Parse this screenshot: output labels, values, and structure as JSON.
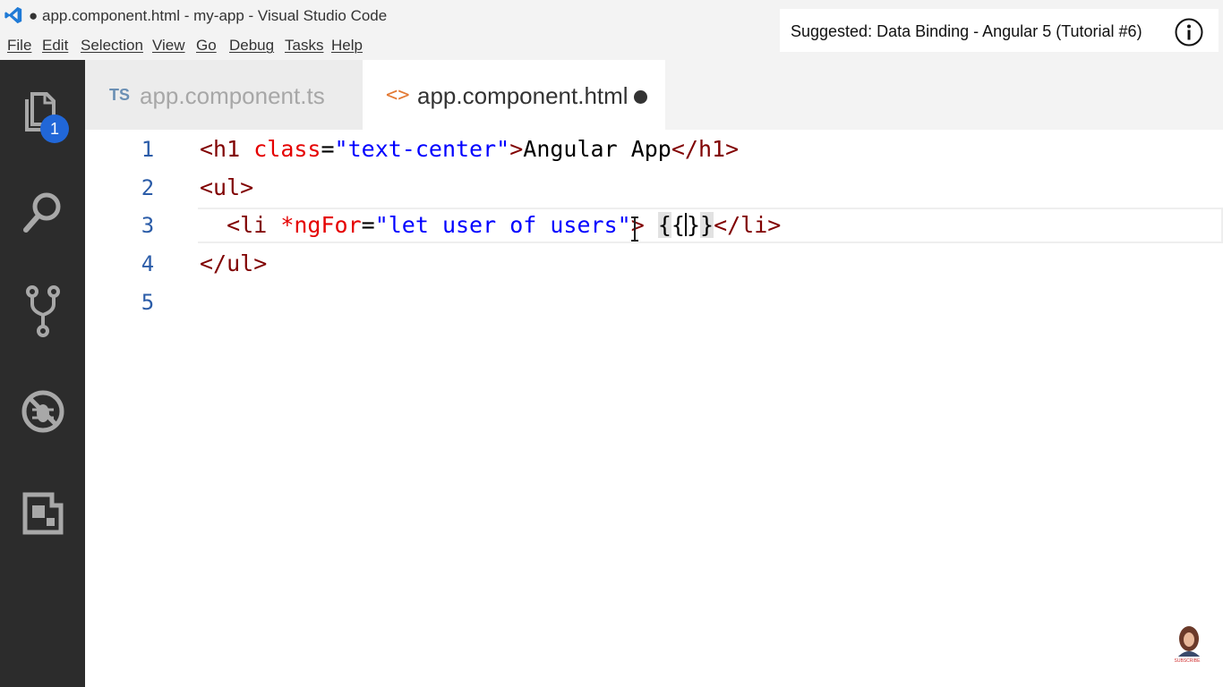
{
  "window": {
    "title": "● app.component.html - my-app - Visual Studio Code",
    "logo_icon": "vscode-logo-icon"
  },
  "menu": [
    "File",
    "Edit",
    "Selection",
    "View",
    "Go",
    "Debug",
    "Tasks",
    "Help"
  ],
  "suggestion": {
    "text": "Suggested: Data Binding - Angular 5 (Tutorial #6)",
    "icon": "info-icon"
  },
  "activity_bar": {
    "items": [
      "explorer-icon",
      "search-icon",
      "source-control-icon",
      "debug-icon",
      "extensions-icon"
    ],
    "explorer_badge": "1",
    "background": "#2c2c2c"
  },
  "tabs": [
    {
      "icon_text": "TS",
      "label": "app.component.ts",
      "active": false
    },
    {
      "icon_text": "<>",
      "label": "app.component.html",
      "active": true,
      "dirty": true
    }
  ],
  "editor": {
    "line_numbers": [
      "1",
      "2",
      "3",
      "4",
      "5"
    ],
    "lines": [
      [
        {
          "cls": "t-tag",
          "text": "<h1"
        },
        {
          "cls": "t-punct",
          "text": " "
        },
        {
          "cls": "t-attr",
          "text": "class"
        },
        {
          "cls": "t-punct",
          "text": "="
        },
        {
          "cls": "t-str",
          "text": "\"text-center\""
        },
        {
          "cls": "t-tag",
          "text": ">"
        },
        {
          "cls": "t-punct",
          "text": "Angular App"
        },
        {
          "cls": "t-tag",
          "text": "</h1>"
        }
      ],
      [
        {
          "cls": "t-tag",
          "text": "<ul>"
        }
      ],
      [
        {
          "cls": "t-punct",
          "text": "  "
        },
        {
          "cls": "t-tag",
          "text": "<li"
        },
        {
          "cls": "t-punct",
          "text": " "
        },
        {
          "cls": "t-attr",
          "text": "*ngFor"
        },
        {
          "cls": "t-punct",
          "text": "="
        },
        {
          "cls": "t-str",
          "text": "\"let user of users\""
        },
        {
          "cls": "t-tag",
          "text": ">"
        },
        {
          "cls": "t-punct",
          "text": " "
        },
        {
          "cls": "brace-hl",
          "text": "{"
        },
        {
          "cls": "t-punct",
          "text": "{"
        },
        {
          "cls": "cursor",
          "text": ""
        },
        {
          "cls": "t-punct",
          "text": "}"
        },
        {
          "cls": "brace-hl",
          "text": "}"
        },
        {
          "cls": "t-tag",
          "text": "</li>"
        }
      ],
      [
        {
          "cls": "t-tag",
          "text": "</ul>"
        }
      ],
      []
    ]
  },
  "subscribe_label": "SUBSCRIBE"
}
